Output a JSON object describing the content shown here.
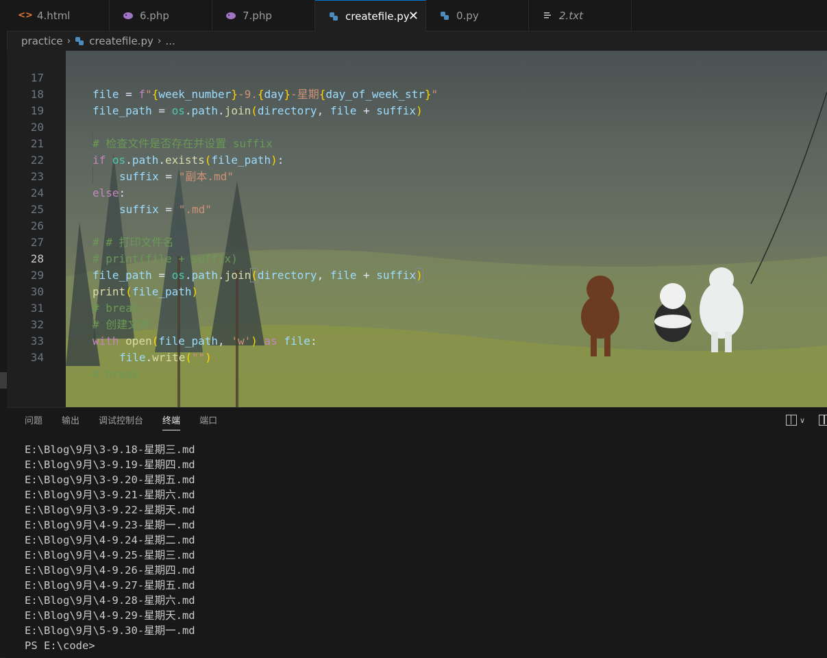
{
  "tabs": [
    {
      "label": "4.html",
      "icon": "html-file-icon",
      "active": false
    },
    {
      "label": "6.php",
      "icon": "php-file-icon",
      "active": false
    },
    {
      "label": "7.php",
      "icon": "php-file-icon",
      "active": false
    },
    {
      "label": "createfile.py",
      "icon": "python-file-icon",
      "active": true
    },
    {
      "label": "0.py",
      "icon": "python-file-icon",
      "active": false
    },
    {
      "label": "2.txt",
      "icon": "text-file-icon",
      "active": false
    }
  ],
  "close_glyph": "✕",
  "breadcrumb": {
    "folder": "practice",
    "file": "createfile.py",
    "more": "..."
  },
  "editor": {
    "current_line": 28,
    "line_numbers": [
      "17",
      "18",
      "19",
      "20",
      "21",
      "22",
      "23",
      "24",
      "25",
      "26",
      "27",
      "28",
      "29",
      "30",
      "31",
      "32",
      "33",
      "34"
    ],
    "lines": [
      "    file = f\"{week_number}-9.{day}-星期{day_of_week_str}\"",
      "    file_path = os.path.join(directory, file + suffix)",
      "",
      "    # 检查文件是否存在并设置 suffix",
      "    if os.path.exists(file_path):",
      "        suffix = \"副本.md\"",
      "    else:",
      "        suffix = \".md\"",
      "",
      "    # # 打印文件名",
      "    # print(file + suffix)",
      "    file_path = os.path.join(directory, file + suffix)",
      "    print(file_path)",
      "    # break",
      "    # 创建文件",
      "    with open(file_path, 'w') as file:",
      "        file.write(\"\")",
      "    # break"
    ]
  },
  "panel": {
    "tabs": [
      "问题",
      "输出",
      "调试控制台",
      "终端",
      "端口"
    ],
    "active_tab": "终端",
    "terminal_lines": [
      "E:\\Blog\\9月\\3-9.18-星期三.md",
      "E:\\Blog\\9月\\3-9.19-星期四.md",
      "E:\\Blog\\9月\\3-9.20-星期五.md",
      "E:\\Blog\\9月\\3-9.21-星期六.md",
      "E:\\Blog\\9月\\3-9.22-星期天.md",
      "E:\\Blog\\9月\\4-9.23-星期一.md",
      "E:\\Blog\\9月\\4-9.24-星期二.md",
      "E:\\Blog\\9月\\4-9.25-星期三.md",
      "E:\\Blog\\9月\\4-9.26-星期四.md",
      "E:\\Blog\\9月\\4-9.27-星期五.md",
      "E:\\Blog\\9月\\4-9.28-星期六.md",
      "E:\\Blog\\9月\\4-9.29-星期天.md",
      "E:\\Blog\\9月\\5-9.30-星期一.md",
      "PS E:\\code>"
    ]
  },
  "colors": {
    "accent": "#0078d4",
    "python_icon": "#4b8bbe",
    "php_icon": "#a074c4",
    "html_icon": "#e37933"
  }
}
